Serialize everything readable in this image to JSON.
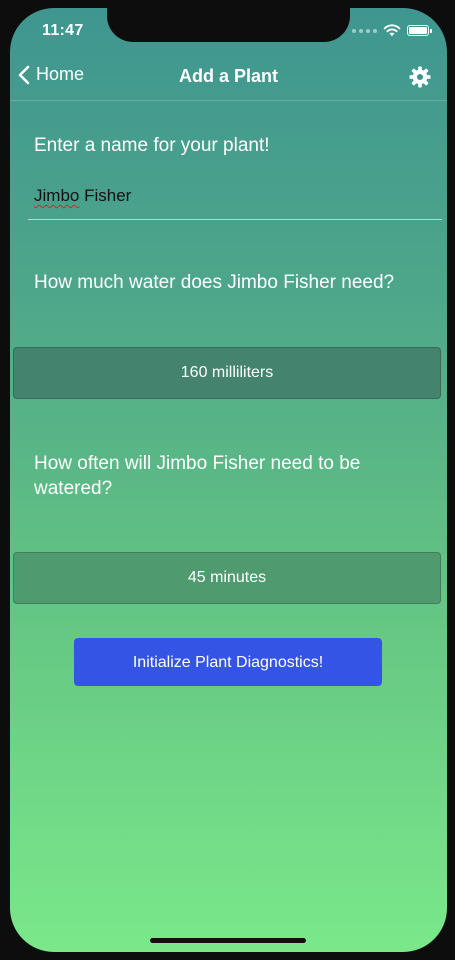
{
  "status_bar": {
    "time": "11:47"
  },
  "nav": {
    "back_label": "Home",
    "title": "Add a Plant"
  },
  "form": {
    "name_prompt": "Enter a name for your plant!",
    "name_value_first": "Jimbo",
    "name_value_rest": " Fisher",
    "water_prompt": "How much water does Jimbo Fisher need?",
    "water_value": "160 milliliters",
    "frequency_prompt": "How often will Jimbo Fisher need to be watered?",
    "frequency_value": "45 minutes",
    "submit_label": "Initialize Plant Diagnostics!"
  },
  "colors": {
    "gradient_top": "#3f9690",
    "gradient_bottom": "#7ae88a",
    "button_blue": "#3454e6"
  }
}
